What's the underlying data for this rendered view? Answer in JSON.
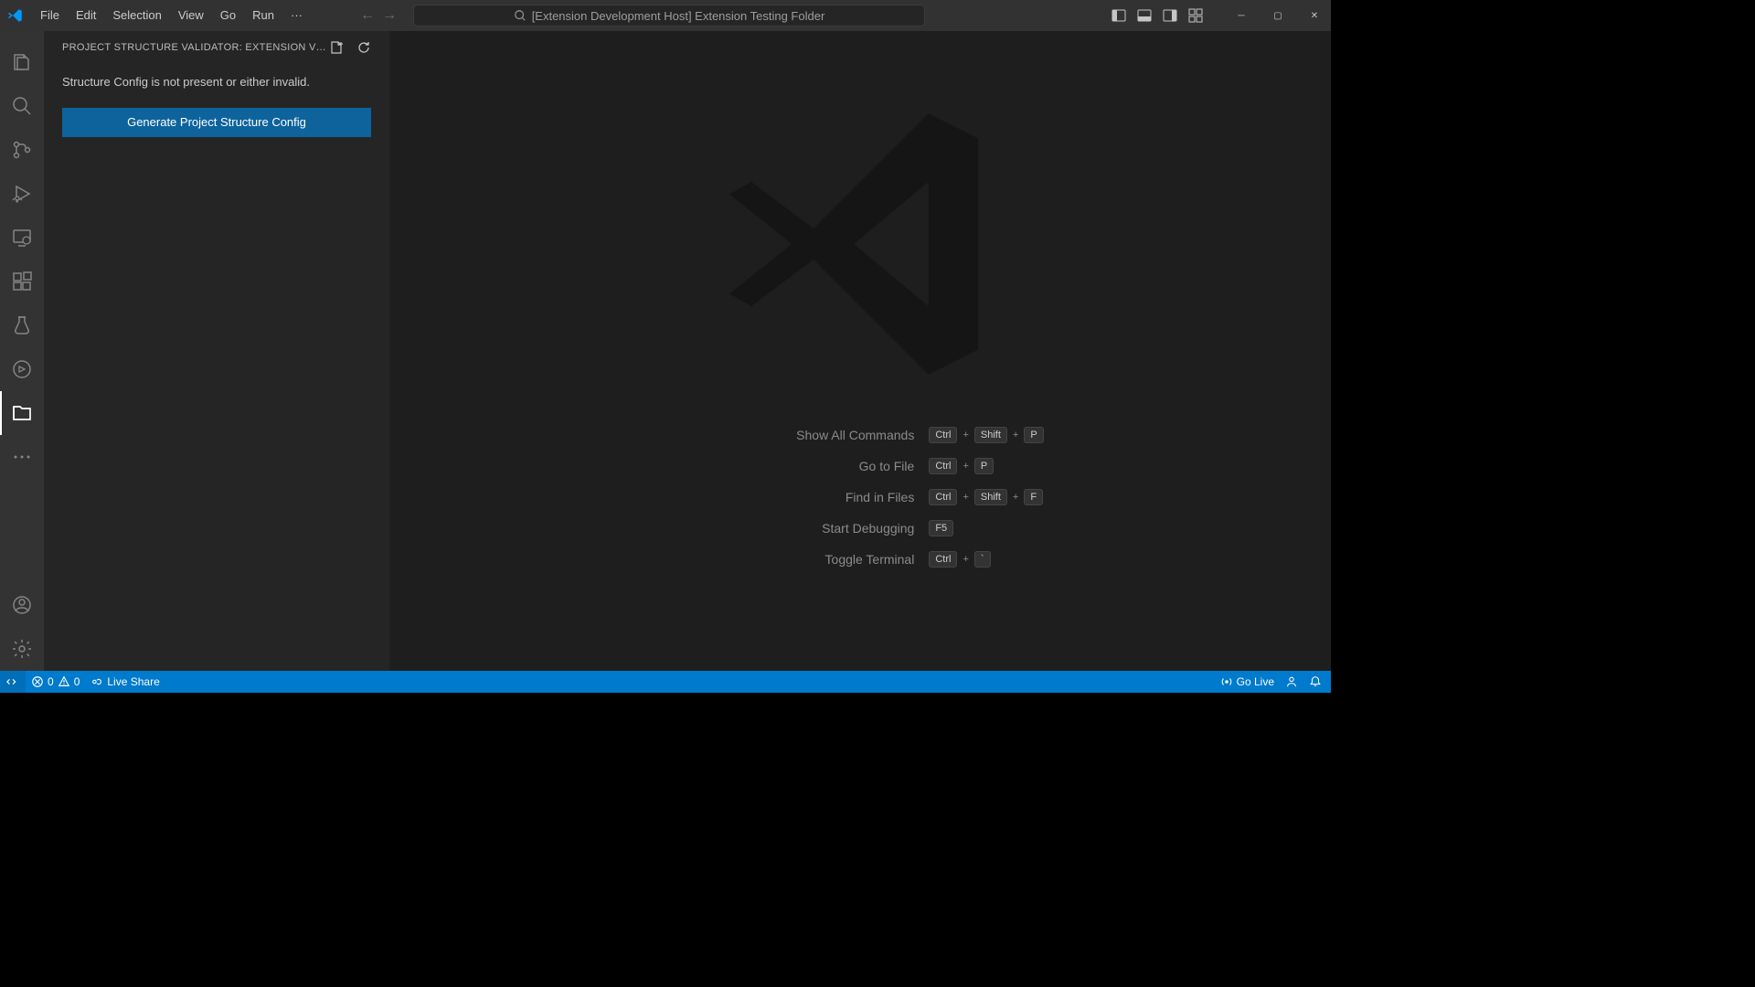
{
  "titlebar": {
    "menu": [
      "File",
      "Edit",
      "Selection",
      "View",
      "Go",
      "Run"
    ],
    "dots": "···",
    "search_text": "[Extension Development Host] Extension Testing Folder"
  },
  "sidebar": {
    "title": "PROJECT STRUCTURE VALIDATOR: EXTENSION VI…",
    "message": "Structure Config is not present or either invalid.",
    "button": "Generate Project Structure Config"
  },
  "shortcuts": [
    {
      "label": "Show All Commands",
      "keys": [
        "Ctrl",
        "+",
        "Shift",
        "+",
        "P"
      ]
    },
    {
      "label": "Go to File",
      "keys": [
        "Ctrl",
        "+",
        "P"
      ]
    },
    {
      "label": "Find in Files",
      "keys": [
        "Ctrl",
        "+",
        "Shift",
        "+",
        "F"
      ]
    },
    {
      "label": "Start Debugging",
      "keys": [
        "F5"
      ]
    },
    {
      "label": "Toggle Terminal",
      "keys": [
        "Ctrl",
        "+",
        "`"
      ]
    }
  ],
  "statusbar": {
    "errors": "0",
    "warnings": "0",
    "live_share": "Live Share",
    "go_live": "Go Live"
  }
}
